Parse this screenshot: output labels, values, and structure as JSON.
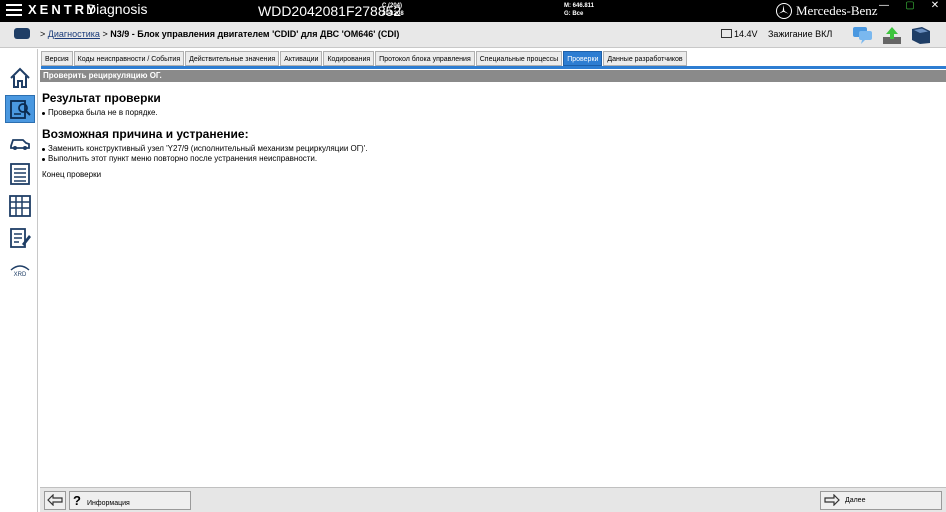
{
  "topbar": {
    "brand": "XENTRY",
    "app": "Diagnosis",
    "vin": "WDD2042081F278852",
    "model_line1": "C (204)",
    "model_line2": "204.208",
    "mileage_line1": "M: 646.811",
    "mileage_line2": "G: Все",
    "maker": "Mercedes-Benz"
  },
  "header": {
    "crumb_link": "Диагностика",
    "crumb_current": "N3/9 - Блок управления двигателем 'CDID' для ДВС 'OM646' (CDI)",
    "voltage": "14.4V",
    "ignition": "Зажигание ВКЛ"
  },
  "tabs": [
    {
      "label": "Версия"
    },
    {
      "label": "Коды неисправности / События"
    },
    {
      "label": "Действительные значения"
    },
    {
      "label": "Активации"
    },
    {
      "label": "Кодирования"
    },
    {
      "label": "Протокол блока управления"
    },
    {
      "label": "Специальные процессы"
    },
    {
      "label": "Проверки"
    },
    {
      "label": "Данные разработчиков"
    }
  ],
  "section_title": "Проверить рециркуляцию ОГ.",
  "content": {
    "result_heading": "Результат проверки",
    "result_item": "Проверка была не в порядке.",
    "cause_heading": "Возможная причина и устранение:",
    "cause_items": [
      "Заменить конструктивный узел 'Y27/9 (исполнительный механизм рециркуляции ОГ)'.",
      "Выполнить этот пункт меню повторно после устранения неисправности."
    ],
    "end_text": "Конец проверки"
  },
  "sidebar": {
    "xrd_label": "XRD"
  },
  "footer": {
    "info_label": "Информация",
    "help_symbol": "?",
    "next_label": "Далее"
  },
  "colors": {
    "accent": "#2d7dd2",
    "section_bar": "#8a8a8a",
    "topbar": "#000000"
  }
}
